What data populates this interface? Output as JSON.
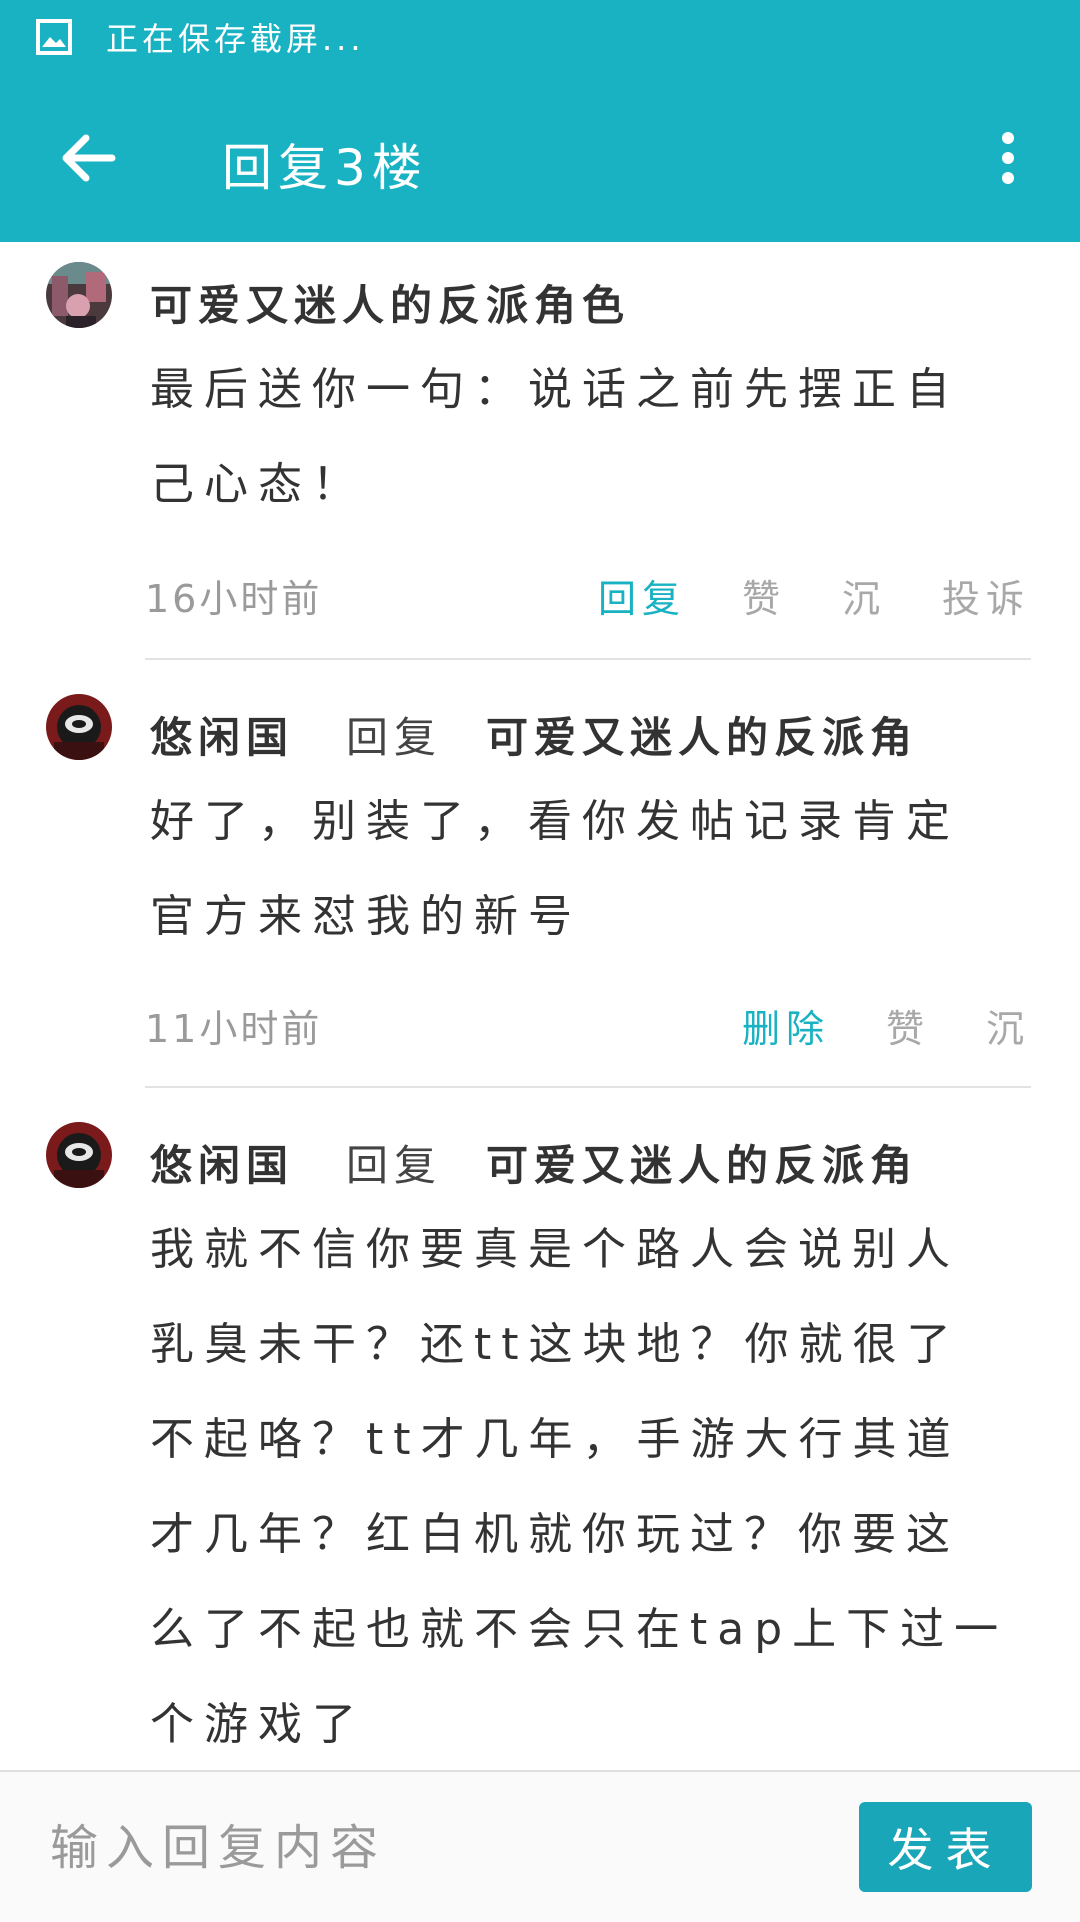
{
  "status_bar": {
    "text": "正在保存截屏...",
    "icon": "image-icon"
  },
  "app_bar": {
    "title": "回复3楼",
    "back_icon": "arrow-left-icon",
    "more_icon": "more-vert-icon"
  },
  "comments": [
    {
      "author": "可爱又迷人的反派角色",
      "body": "最后送你一句：说话之前先摆正自己心态！",
      "time": "16小时前",
      "actions": [
        "回复",
        "赞",
        "沉",
        "投诉"
      ]
    },
    {
      "author": "悠闲国",
      "reply_word": "回复",
      "reply_to": "可爱又迷人的反派角",
      "body": "好了，别装了，看你发帖记录肯定官方来怼我的新号",
      "time": "11小时前",
      "actions": [
        "删除",
        "赞",
        "沉"
      ]
    },
    {
      "author": "悠闲国",
      "reply_word": "回复",
      "reply_to": "可爱又迷人的反派角",
      "body": "我就不信你要真是个路人会说别人乳臭未干？还tt这块地？你就很了不起咯？tt才几年，手游大行其道才几年？红白机就你玩过？你要这么了不起也就不会只在tap上下过一个游戏了"
    }
  ],
  "reply_bar": {
    "placeholder": "输入回复内容",
    "send_label": "发表"
  },
  "colors": {
    "accent": "#19b2c3",
    "muted": "#a8a8a8"
  }
}
